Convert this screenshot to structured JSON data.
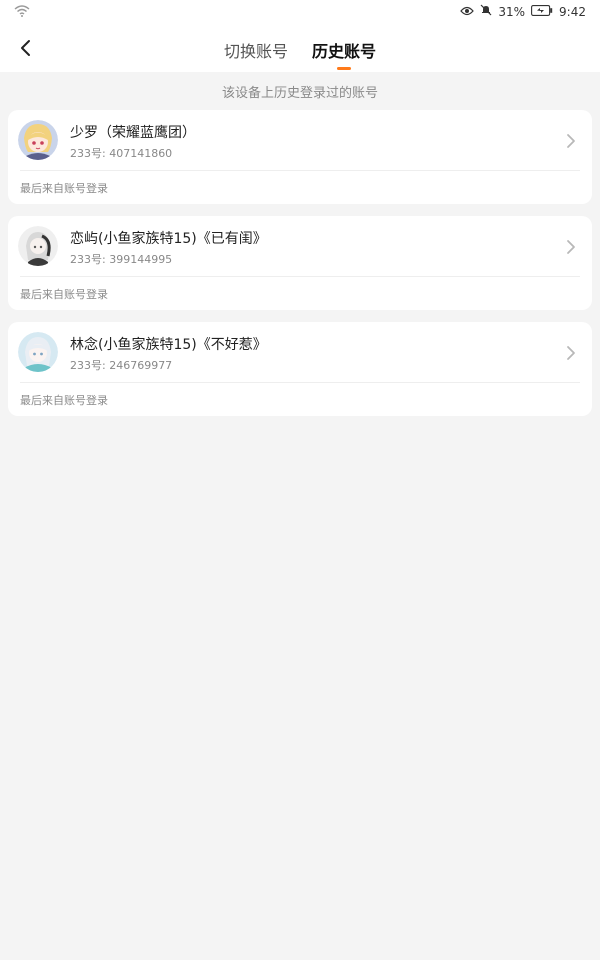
{
  "status_bar": {
    "battery_percent": "31%",
    "time": "9:42",
    "icons": [
      "wifi-icon",
      "eye-icon",
      "mute-bell-icon",
      "battery-icon"
    ]
  },
  "header": {
    "back_icon": "chevron-left-icon",
    "tabs": [
      {
        "label": "切换账号",
        "active": false
      },
      {
        "label": "历史账号",
        "active": true
      }
    ],
    "accent_color": "#ff7a1a"
  },
  "subtitle": "该设备上历史登录过的账号",
  "accounts": [
    {
      "name": "少罗（荣耀蓝鹰团）",
      "uid": "233号: 407141860",
      "login_note": "最后来自账号登录"
    },
    {
      "name": "恋屿(小鱼家族特15)《已有闺》",
      "uid": "233号: 399144995",
      "login_note": "最后来自账号登录"
    },
    {
      "name": "林念(小鱼家族特15)《不好惹》",
      "uid": "233号: 246769977",
      "login_note": "最后来自账号登录"
    }
  ]
}
